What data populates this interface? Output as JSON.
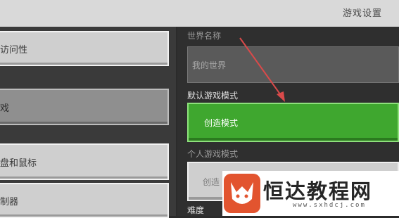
{
  "header": {
    "title": "游戏设置"
  },
  "sidebar": {
    "items": [
      {
        "label": "访问性",
        "active": false
      },
      {
        "label": "戏",
        "active": true
      },
      {
        "label": "盘和鼠标",
        "active": false
      },
      {
        "label": "制器",
        "active": false
      }
    ]
  },
  "settings": {
    "world_name_label": "世界名称",
    "world_name_value": "我的世界",
    "default_mode_label": "默认游戏模式",
    "default_mode_value": "创造模式",
    "personal_mode_label": "个人游戏模式",
    "personal_mode_value": "创造",
    "difficulty_label": "难度"
  },
  "watermark": {
    "brand": "恒达教程网",
    "url": "www.sxhdcj.com"
  },
  "colors": {
    "accent_green": "#3fa72f",
    "arrow_red": "#d94a4a"
  }
}
